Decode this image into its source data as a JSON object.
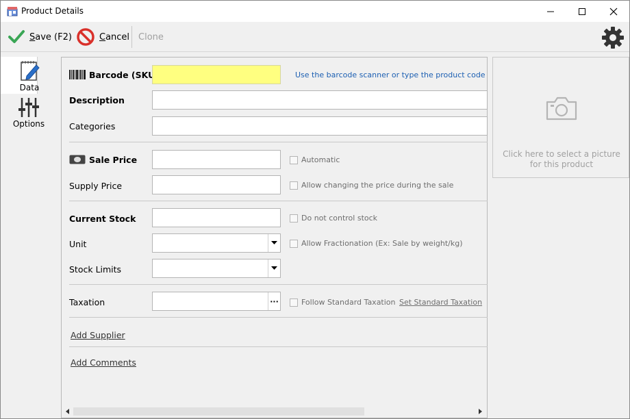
{
  "window": {
    "title": "Product Details"
  },
  "toolbar": {
    "save_label": "Save (F2)",
    "save_underline": "S",
    "save_rest": "ave (F2)",
    "cancel_underline": "C",
    "cancel_rest": "ancel",
    "clone_label": "Clone"
  },
  "nav": {
    "data_label": "Data",
    "options_label": "Options"
  },
  "form": {
    "barcode_label": "Barcode (SKU)",
    "barcode_value": "",
    "barcode_hint": "Use the barcode scanner or type the product code",
    "description_label": "Description",
    "description_value": "",
    "categories_label": "Categories",
    "categories_value": "",
    "sale_price_label": "Sale Price",
    "sale_price_value": "",
    "automatic_label": "Automatic",
    "automatic_checked": false,
    "supply_price_label": "Supply Price",
    "supply_price_value": "",
    "allow_change_price_label": "Allow changing the price during the sale",
    "allow_change_price_checked": false,
    "current_stock_label": "Current Stock",
    "current_stock_value": "",
    "no_control_stock_label": "Do not control stock",
    "no_control_stock_checked": false,
    "unit_label": "Unit",
    "unit_value": "",
    "allow_fraction_label": "Allow Fractionation (Ex: Sale by weight/kg)",
    "allow_fraction_checked": false,
    "stock_limits_label": "Stock Limits",
    "stock_limits_value": "",
    "taxation_label": "Taxation",
    "taxation_value": "",
    "taxation_button": "···",
    "follow_std_tax_label": "Follow Standard Taxation",
    "follow_std_tax_checked": false,
    "set_std_tax_link": "Set Standard Taxation",
    "add_supplier_link": "Add Supplier",
    "add_comments_link": "Add Comments"
  },
  "picture": {
    "prompt": "Click here to select a picture for this product"
  },
  "colors": {
    "barcode_bg": "#ffff80",
    "hint_blue": "#1c5fb2",
    "save_green": "#3aa655",
    "cancel_red": "#d9312b"
  },
  "icons": {
    "app": "app-store-icon",
    "save": "checkmark-icon",
    "cancel": "no-entry-icon",
    "settings": "gear-icon",
    "data": "notepad-pencil-icon",
    "options": "sliders-icon",
    "barcode": "barcode-icon",
    "money": "banknote-icon",
    "picture": "camera-icon"
  }
}
